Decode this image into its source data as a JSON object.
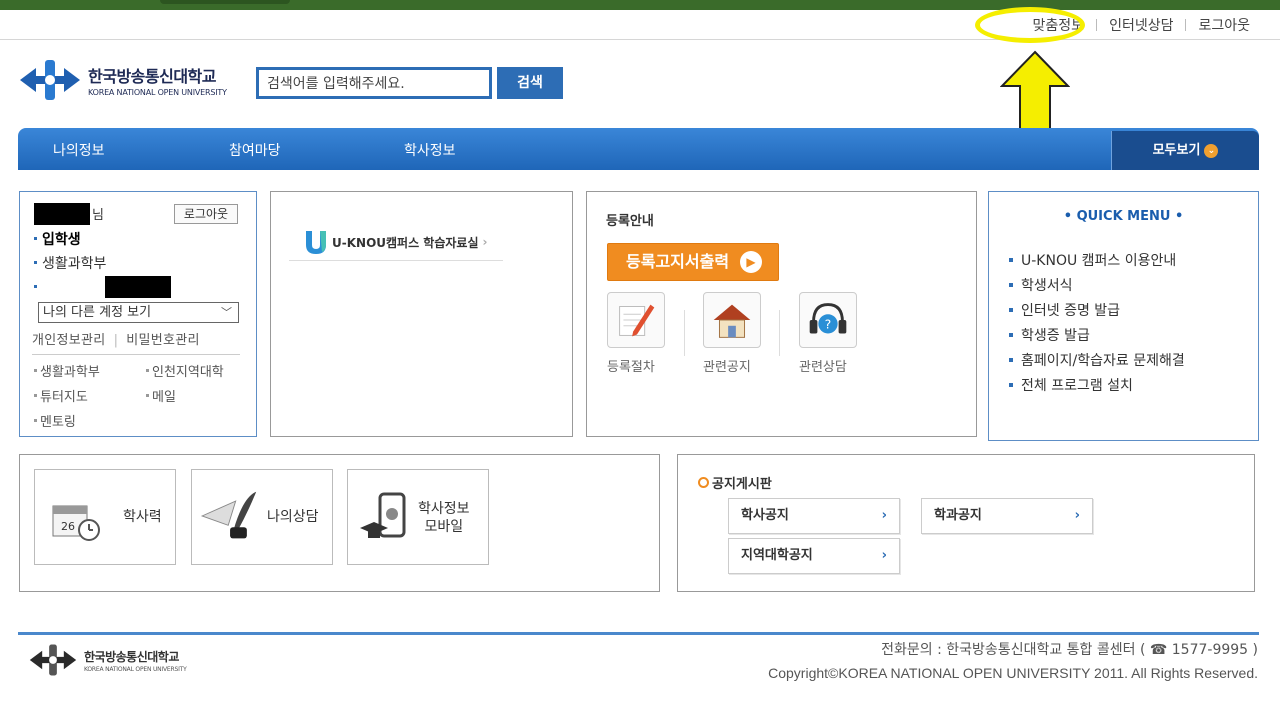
{
  "util_links": [
    "맞춤정보",
    "인터넷상담",
    "로그아웃"
  ],
  "logo": {
    "kr": "한국방송통신대학교",
    "en": "KOREA NATIONAL OPEN UNIVERSITY"
  },
  "search": {
    "value": "검색어를 입력해주세요.",
    "button": "검색"
  },
  "nav": {
    "items": [
      "나의정보",
      "참여마당",
      "학사정보"
    ],
    "all": "모두보기"
  },
  "user": {
    "suffix": "님",
    "logout": "로그아웃",
    "status": "입학생",
    "department": "생활과학부",
    "account_select": "나의 다른 계정 보기",
    "profile_mgmt": "개인정보관리",
    "password_mgmt": "비밀번호관리",
    "links": [
      "생활과학부",
      "인천지역대학",
      "튜터지도",
      "메일",
      "멘토링"
    ]
  },
  "campus": {
    "link": "U-KNOU캠퍼스 학습자료실"
  },
  "registration": {
    "title": "등록안내",
    "print_button": "등록고지서출력",
    "icons": [
      "등록절차",
      "관련공지",
      "관련상담"
    ]
  },
  "quick_menu": {
    "title": "QUICK MENU",
    "items": [
      "U-KNOU 캠퍼스 이용안내",
      "학생서식",
      "인터넷 증명 발급",
      "학생증 발급",
      "홈페이지/학습자료 문제해결",
      "전체 프로그램 설치"
    ]
  },
  "tiles": [
    "학사력",
    "나의상담",
    "학사정보\n모바일"
  ],
  "notice": {
    "title": "공지게시판",
    "buttons": [
      "학사공지",
      "학과공지",
      "지역대학공지"
    ]
  },
  "footer": {
    "contact": "전화문의 : 한국방송통신대학교 통합 콜센터 ( ☎ 1577-9995 )",
    "copyright": "Copyright©KOREA NATIONAL OPEN UNIVERSITY 2011. All Rights Reserved."
  },
  "colors": {
    "topbar": "#3a6b2a",
    "primary": "#2d6db5",
    "accent": "#f08c20",
    "highlight": "#f5ee00"
  }
}
